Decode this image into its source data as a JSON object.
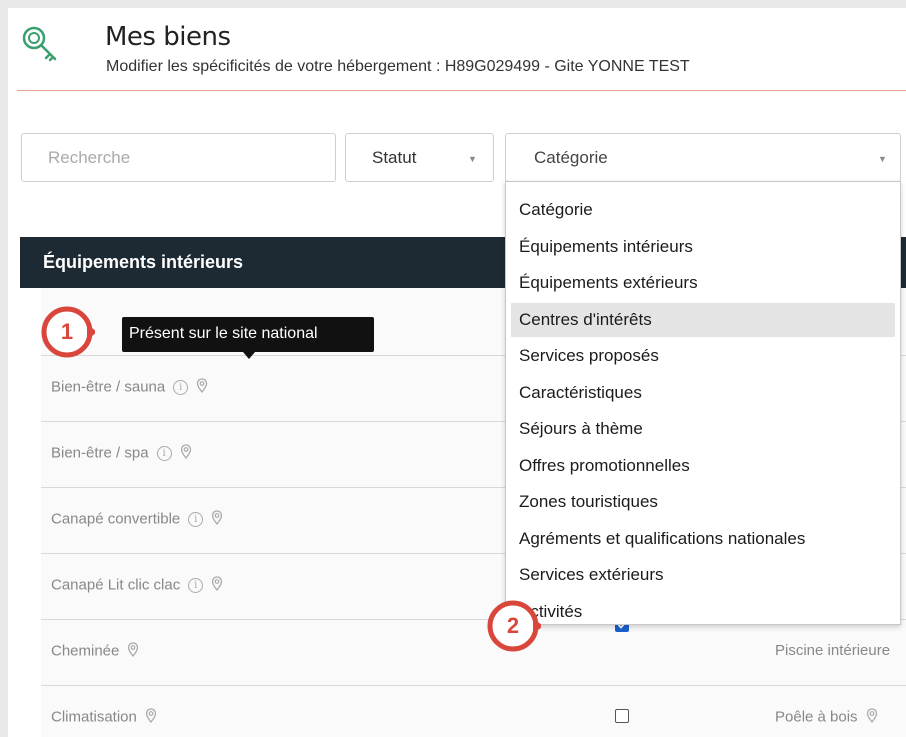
{
  "header": {
    "icon": "key-search-icon",
    "title": "Mes biens",
    "subtitle": "Modifier les spécificités de votre hébergement : H89G029499 - Gite YONNE TEST"
  },
  "filters": {
    "search_placeholder": "Recherche",
    "statut_label": "Statut",
    "categorie_label": "Catégorie",
    "caret": "▼"
  },
  "section": {
    "title": "Équipements intérieurs"
  },
  "tooltip": {
    "text": "Présent sur le site national"
  },
  "rows": [
    {
      "label": "Bien-être / sauna",
      "info": true,
      "pin": true,
      "checked": null,
      "right": ""
    },
    {
      "label": "Bien-être / spa",
      "info": true,
      "pin": true,
      "checked": null,
      "right": ""
    },
    {
      "label": "Canapé convertible",
      "info": true,
      "pin": true,
      "checked": null,
      "right": ""
    },
    {
      "label": "Canapé Lit clic clac",
      "info": true,
      "pin": true,
      "checked": null,
      "right": ""
    },
    {
      "label": "Cheminée",
      "info": false,
      "pin": true,
      "checked": true,
      "right": "Piscine intérieure"
    },
    {
      "label": "Climatisation",
      "info": false,
      "pin": true,
      "checked": false,
      "right": "Poêle à bois"
    }
  ],
  "dropdown": {
    "highlighted_index": 3,
    "options": [
      "Catégorie",
      "Équipements intérieurs",
      "Équipements extérieurs",
      "Centres d'intérêts",
      "Services proposés",
      "Caractéristiques",
      "Séjours à thème",
      "Offres promotionnelles",
      "Zones touristiques",
      "Agréments et qualifications nationales",
      "Services extérieurs",
      "Activités"
    ]
  },
  "callouts": [
    "1",
    "2"
  ],
  "colors": {
    "accent": "#d9463b",
    "section_bg": "#1e2a33",
    "checkbox_on": "#1a5fcf",
    "rule": "#e8a493"
  }
}
